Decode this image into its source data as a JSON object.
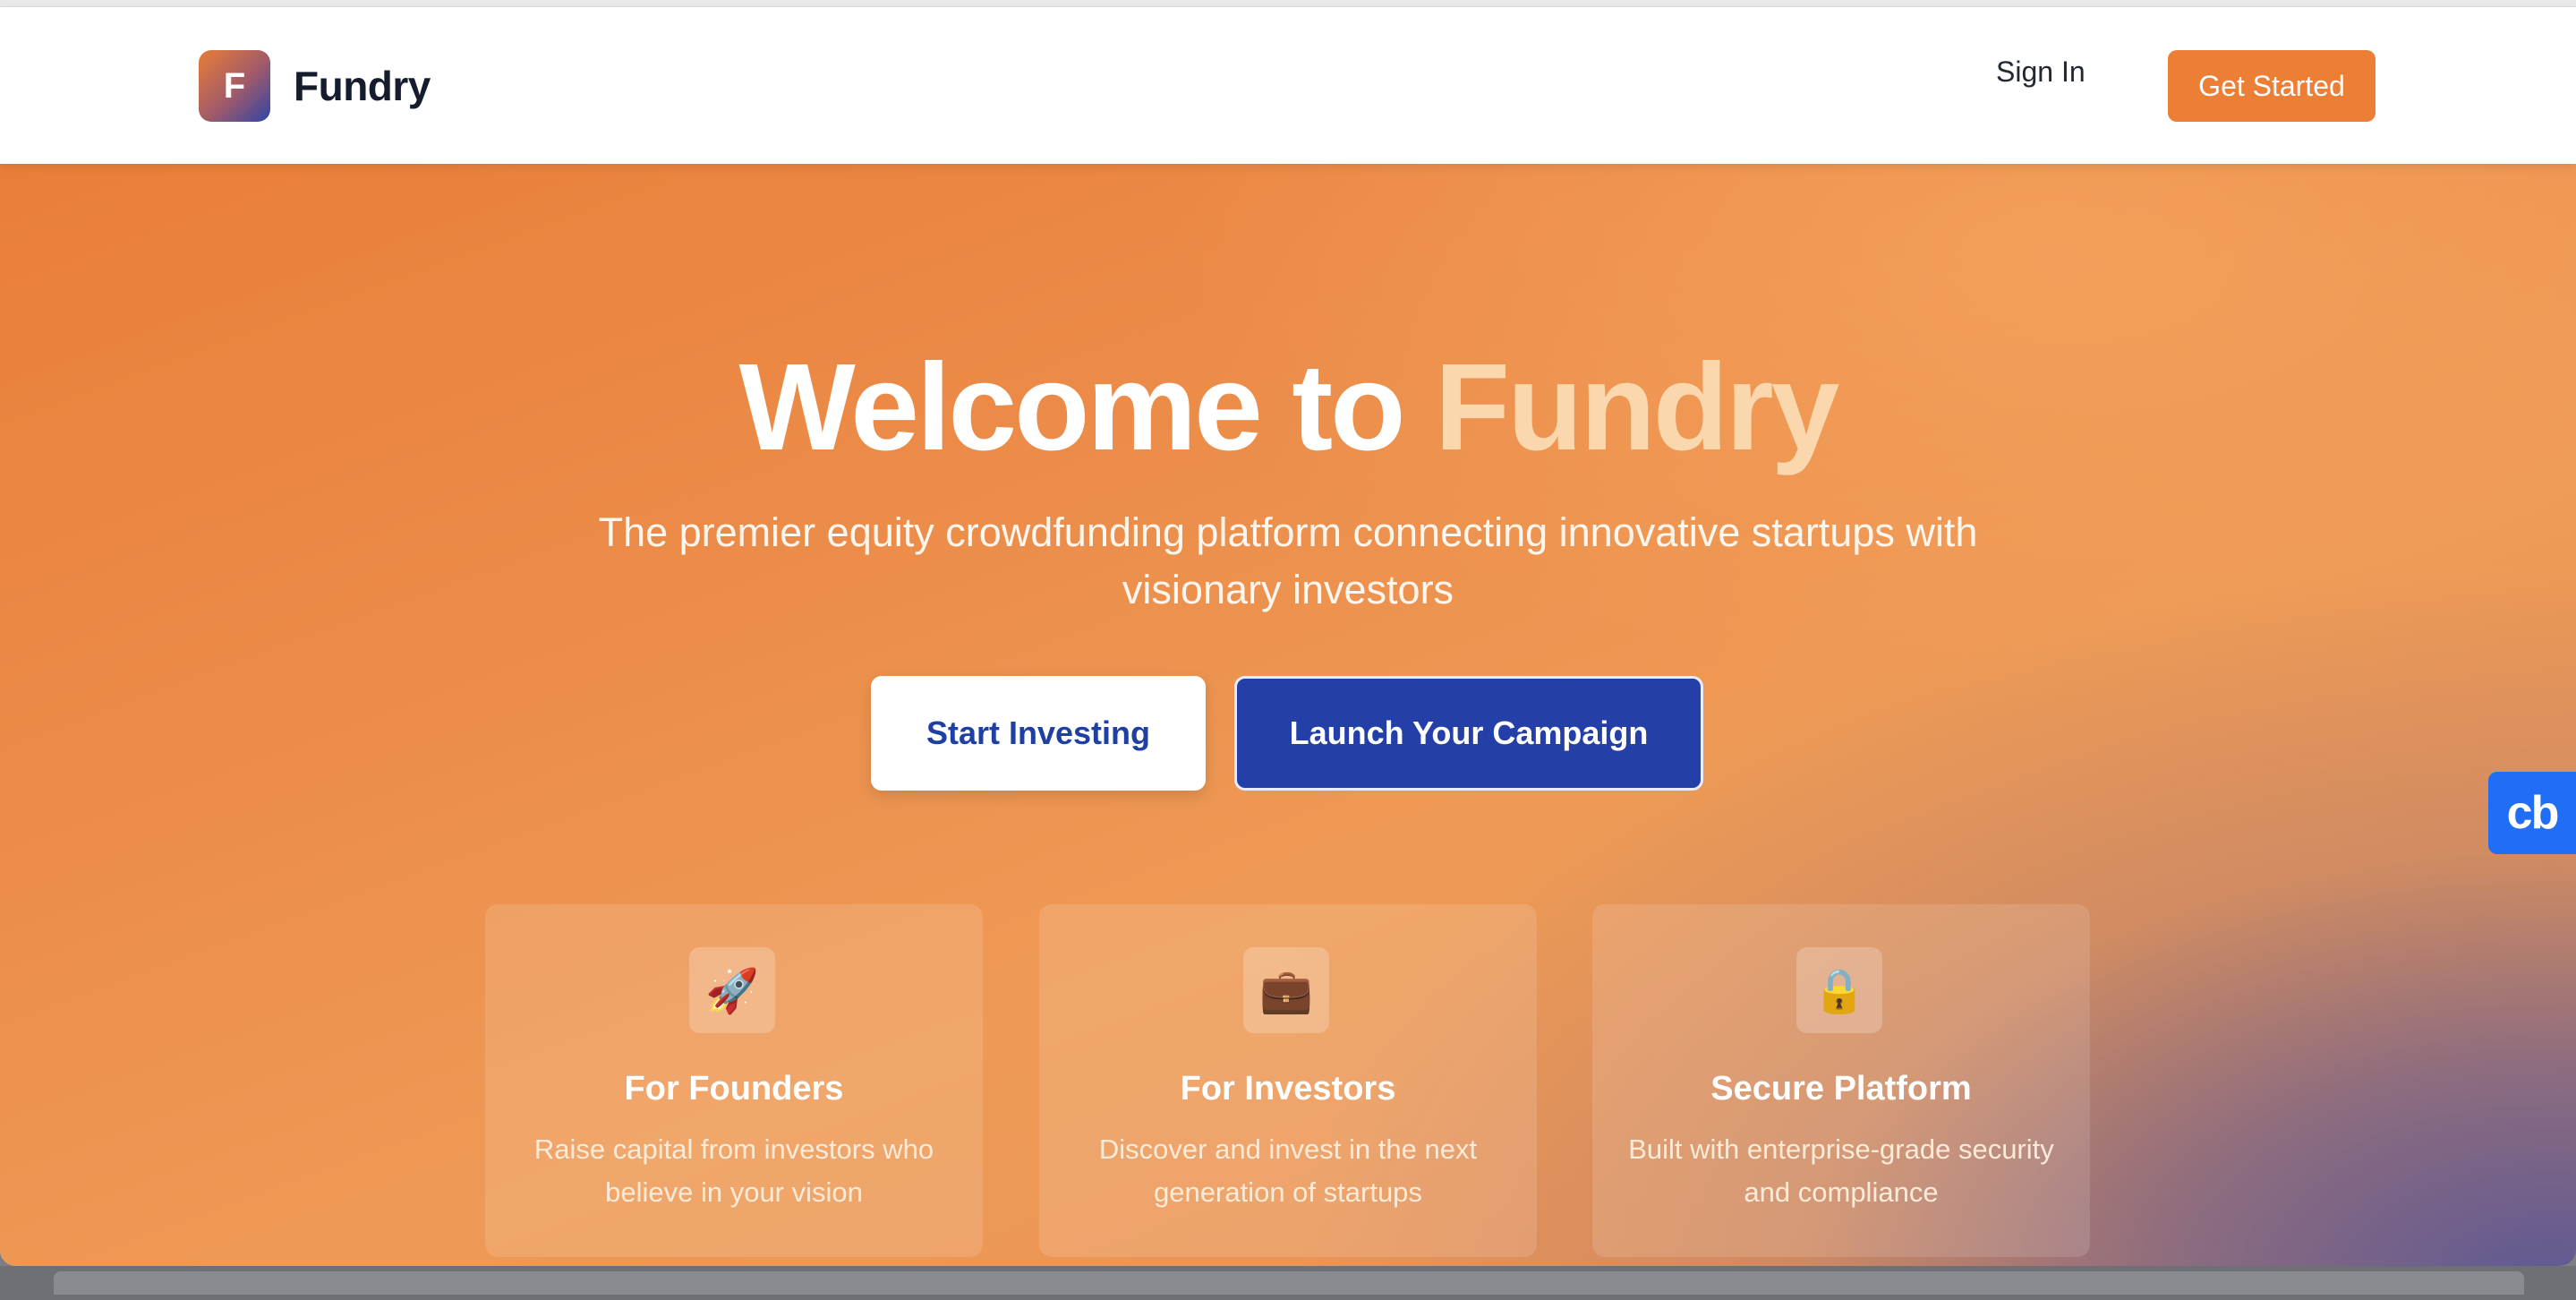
{
  "brand": {
    "logo_letter": "F",
    "name": "Fundry"
  },
  "nav": {
    "sign_in": "Sign In",
    "get_started": "Get Started"
  },
  "hero": {
    "title_prefix": "Welcome to ",
    "title_accent": "Fundry",
    "subtitle": "The premier equity crowdfunding platform connecting innovative startups with visionary investors",
    "primary_button": "Start Investing",
    "secondary_button": "Launch Your Campaign"
  },
  "features": [
    {
      "icon": "🚀",
      "icon_name": "rocket-icon",
      "title": "For Founders",
      "description": "Raise capital from investors who believe in your vision"
    },
    {
      "icon": "💼",
      "icon_name": "briefcase-icon",
      "title": "For Investors",
      "description": "Discover and invest in the next generation of startups"
    },
    {
      "icon": "🔒",
      "icon_name": "lock-icon",
      "title": "Secure Platform",
      "description": "Built with enterprise-grade security and compliance"
    }
  ],
  "floating_badge": {
    "label": "cb"
  },
  "colors": {
    "accent_orange": "#ec7e36",
    "primary_blue": "#2440a8",
    "title_accent": "#fbd7ad",
    "badge_blue": "#1f6ef5"
  }
}
